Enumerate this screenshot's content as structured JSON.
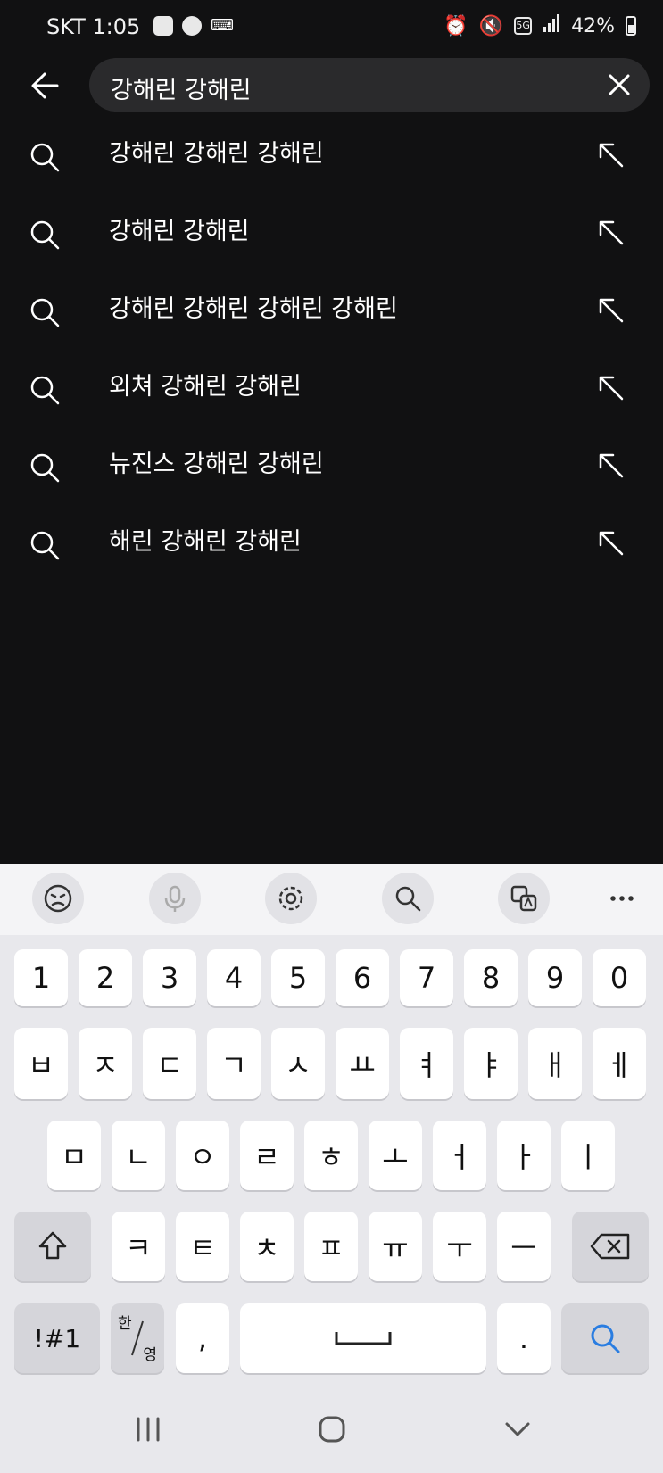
{
  "status": {
    "carrier_time": "SKT 1:05",
    "network": "5G",
    "battery": "42%"
  },
  "search": {
    "query": "강해린 강해린"
  },
  "suggestions": [
    "강해린 강해린 강해린",
    "강해린 강해린",
    "강해린 강해린 강해린 강해린",
    "외쳐 강해린 강해린",
    "뉴진스 강해린 강해린",
    "해린 강해린 강해린"
  ],
  "keyboard": {
    "numbers": [
      "1",
      "2",
      "3",
      "4",
      "5",
      "6",
      "7",
      "8",
      "9",
      "0"
    ],
    "row1": [
      "ㅂ",
      "ㅈ",
      "ㄷ",
      "ㄱ",
      "ㅅ",
      "ㅛ",
      "ㅕ",
      "ㅑ",
      "ㅐ",
      "ㅔ"
    ],
    "row2": [
      "ㅁ",
      "ㄴ",
      "ㅇ",
      "ㄹ",
      "ㅎ",
      "ㅗ",
      "ㅓ",
      "ㅏ",
      "ㅣ"
    ],
    "row3": [
      "ㅋ",
      "ㅌ",
      "ㅊ",
      "ㅍ",
      "ㅠ",
      "ㅜ",
      "ㅡ"
    ],
    "symbols_label": "!#1",
    "lang_top": "한",
    "lang_bottom": "영",
    "comma": ",",
    "period": "."
  }
}
